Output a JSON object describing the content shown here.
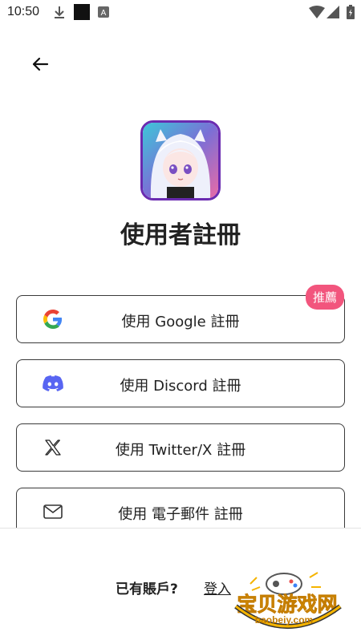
{
  "status_bar": {
    "time": "10:50",
    "icons": [
      "download-icon",
      "square-icon",
      "a-icon",
      "wifi-icon",
      "signal-icon",
      "battery-icon"
    ]
  },
  "header": {
    "back_icon": "arrow-left-icon"
  },
  "app": {
    "icon_name": "anime-girl-app-icon",
    "title": "使用者註冊"
  },
  "signup_options": [
    {
      "label": "使用 Google 註冊",
      "icon": "google-icon",
      "badge": "推薦"
    },
    {
      "label": "使用 Discord 註冊",
      "icon": "discord-icon"
    },
    {
      "label": "使用 Twitter/X 註冊",
      "icon": "x-icon"
    },
    {
      "label": "使用 電子郵件 註冊",
      "icon": "mail-icon"
    }
  ],
  "footer": {
    "have_account": "已有賬戶?",
    "login": "登入"
  },
  "watermark": {
    "text": "宝贝游戏网",
    "url": "baobeiy.com"
  },
  "colors": {
    "badge": "#f2557d",
    "discord": "#5865F2",
    "icon_border": "#6a2bb0"
  }
}
